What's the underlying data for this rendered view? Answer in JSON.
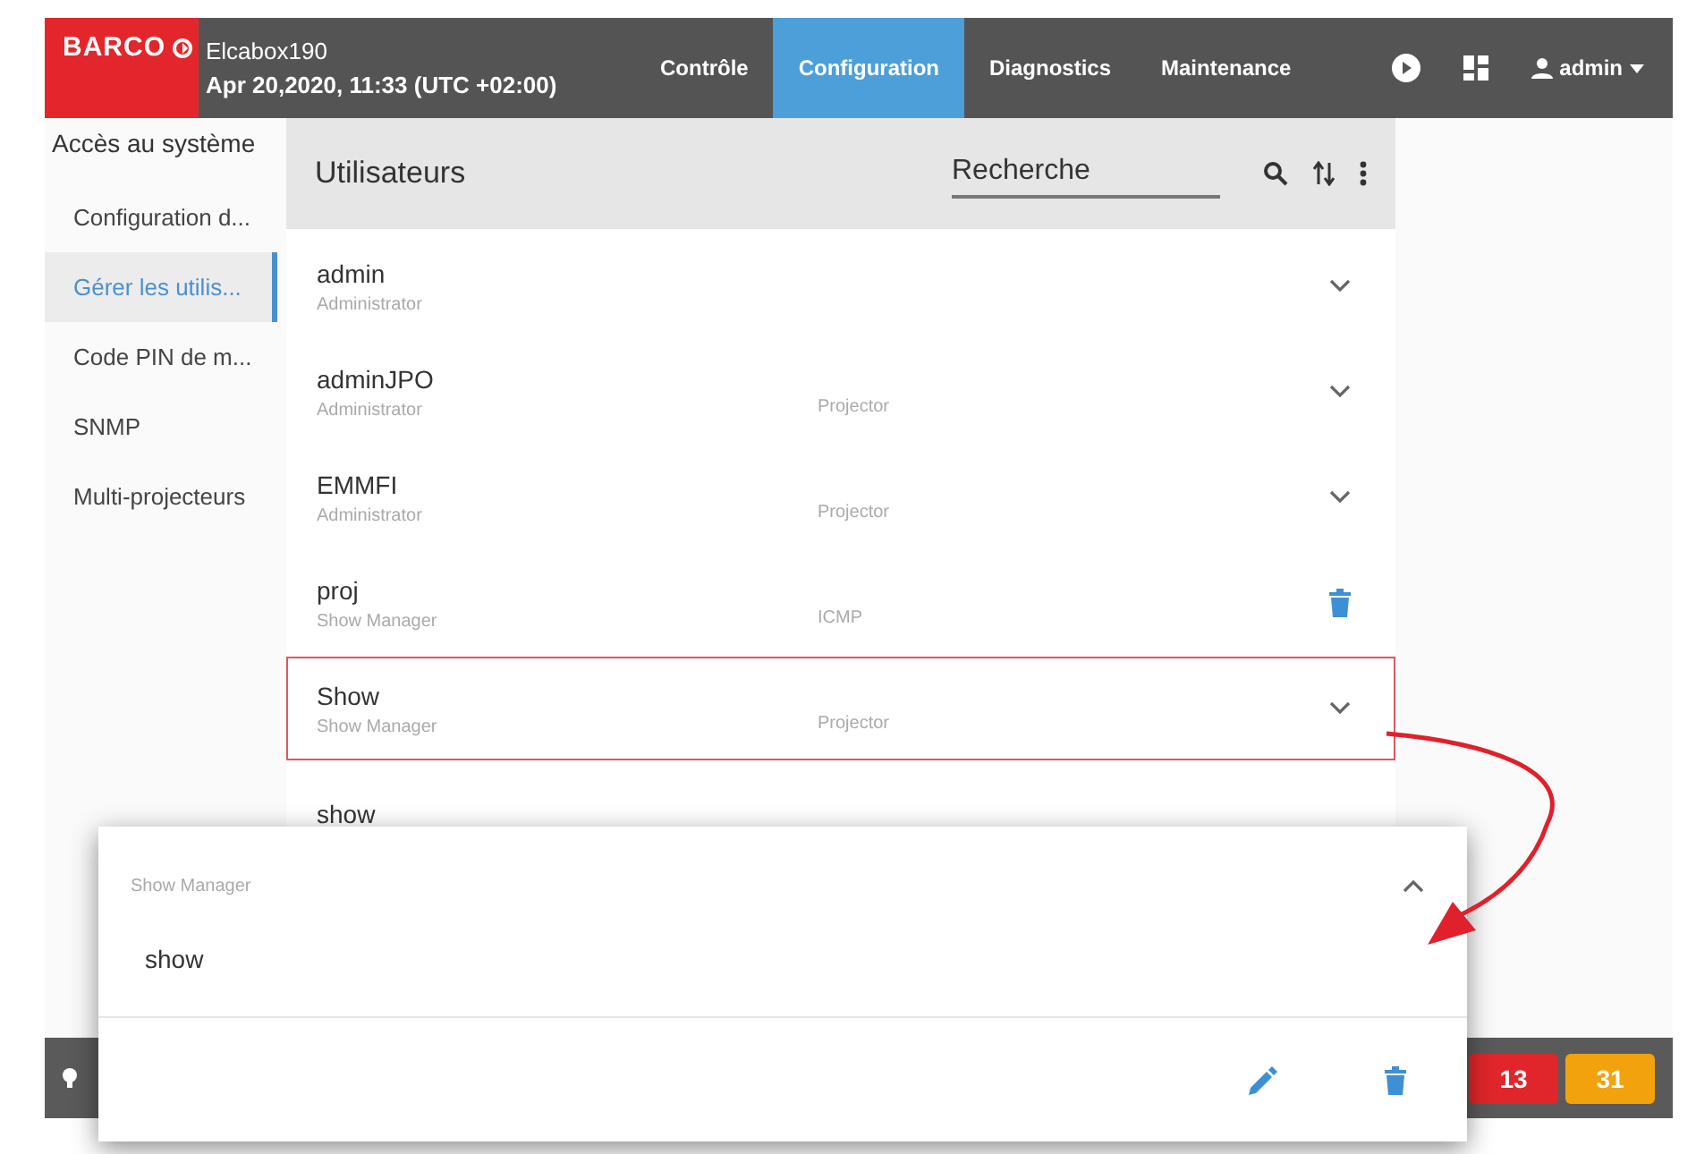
{
  "header": {
    "logo": "BARCO",
    "device": "Elcabox190",
    "datetime": "Apr 20,2020, 11:33 (UTC +02:00)",
    "user": "admin",
    "tabs": [
      {
        "label": "Contrôle",
        "selected": false
      },
      {
        "label": "Configuration",
        "selected": true
      },
      {
        "label": "Diagnostics",
        "selected": false
      },
      {
        "label": "Maintenance",
        "selected": false
      }
    ]
  },
  "sidebar": {
    "heading": "Accès au système",
    "items": [
      {
        "label": "Configuration d...",
        "selected": false
      },
      {
        "label": "Gérer les utilis...",
        "selected": true
      },
      {
        "label": "Code PIN de m...",
        "selected": false
      },
      {
        "label": "SNMP",
        "selected": false
      },
      {
        "label": "Multi-projecteurs",
        "selected": false
      }
    ]
  },
  "panel": {
    "title": "Utilisateurs",
    "search": {
      "placeholder": "Recherche"
    },
    "users": [
      {
        "name": "admin",
        "role": "Administrator",
        "kind": "expand",
        "highlighted": false
      },
      {
        "name": "adminJPO",
        "role": "Administrator",
        "column_3": "Projector",
        "kind": "expand",
        "highlighted": false
      },
      {
        "name": "EMMFI",
        "role": "Administrator",
        "column_3": "Projector",
        "kind": "expand",
        "highlighted": false
      },
      {
        "name": "proj",
        "role": "Show Manager",
        "column_3": "ICMP",
        "kind": "delete",
        "highlighted": false
      },
      {
        "name": "Show",
        "role": "Show Manager",
        "column_3": "Projector",
        "kind": "expand",
        "highlighted": true
      },
      {
        "name": "show",
        "highlighted": false
      }
    ]
  },
  "detail_card": {
    "role": "Show Manager",
    "name": "show",
    "expanded": true
  },
  "status_bar": {
    "badges": [
      {
        "count": "13",
        "color": "#e0262b"
      },
      {
        "count": "31",
        "color": "#f2a20c"
      }
    ]
  }
}
